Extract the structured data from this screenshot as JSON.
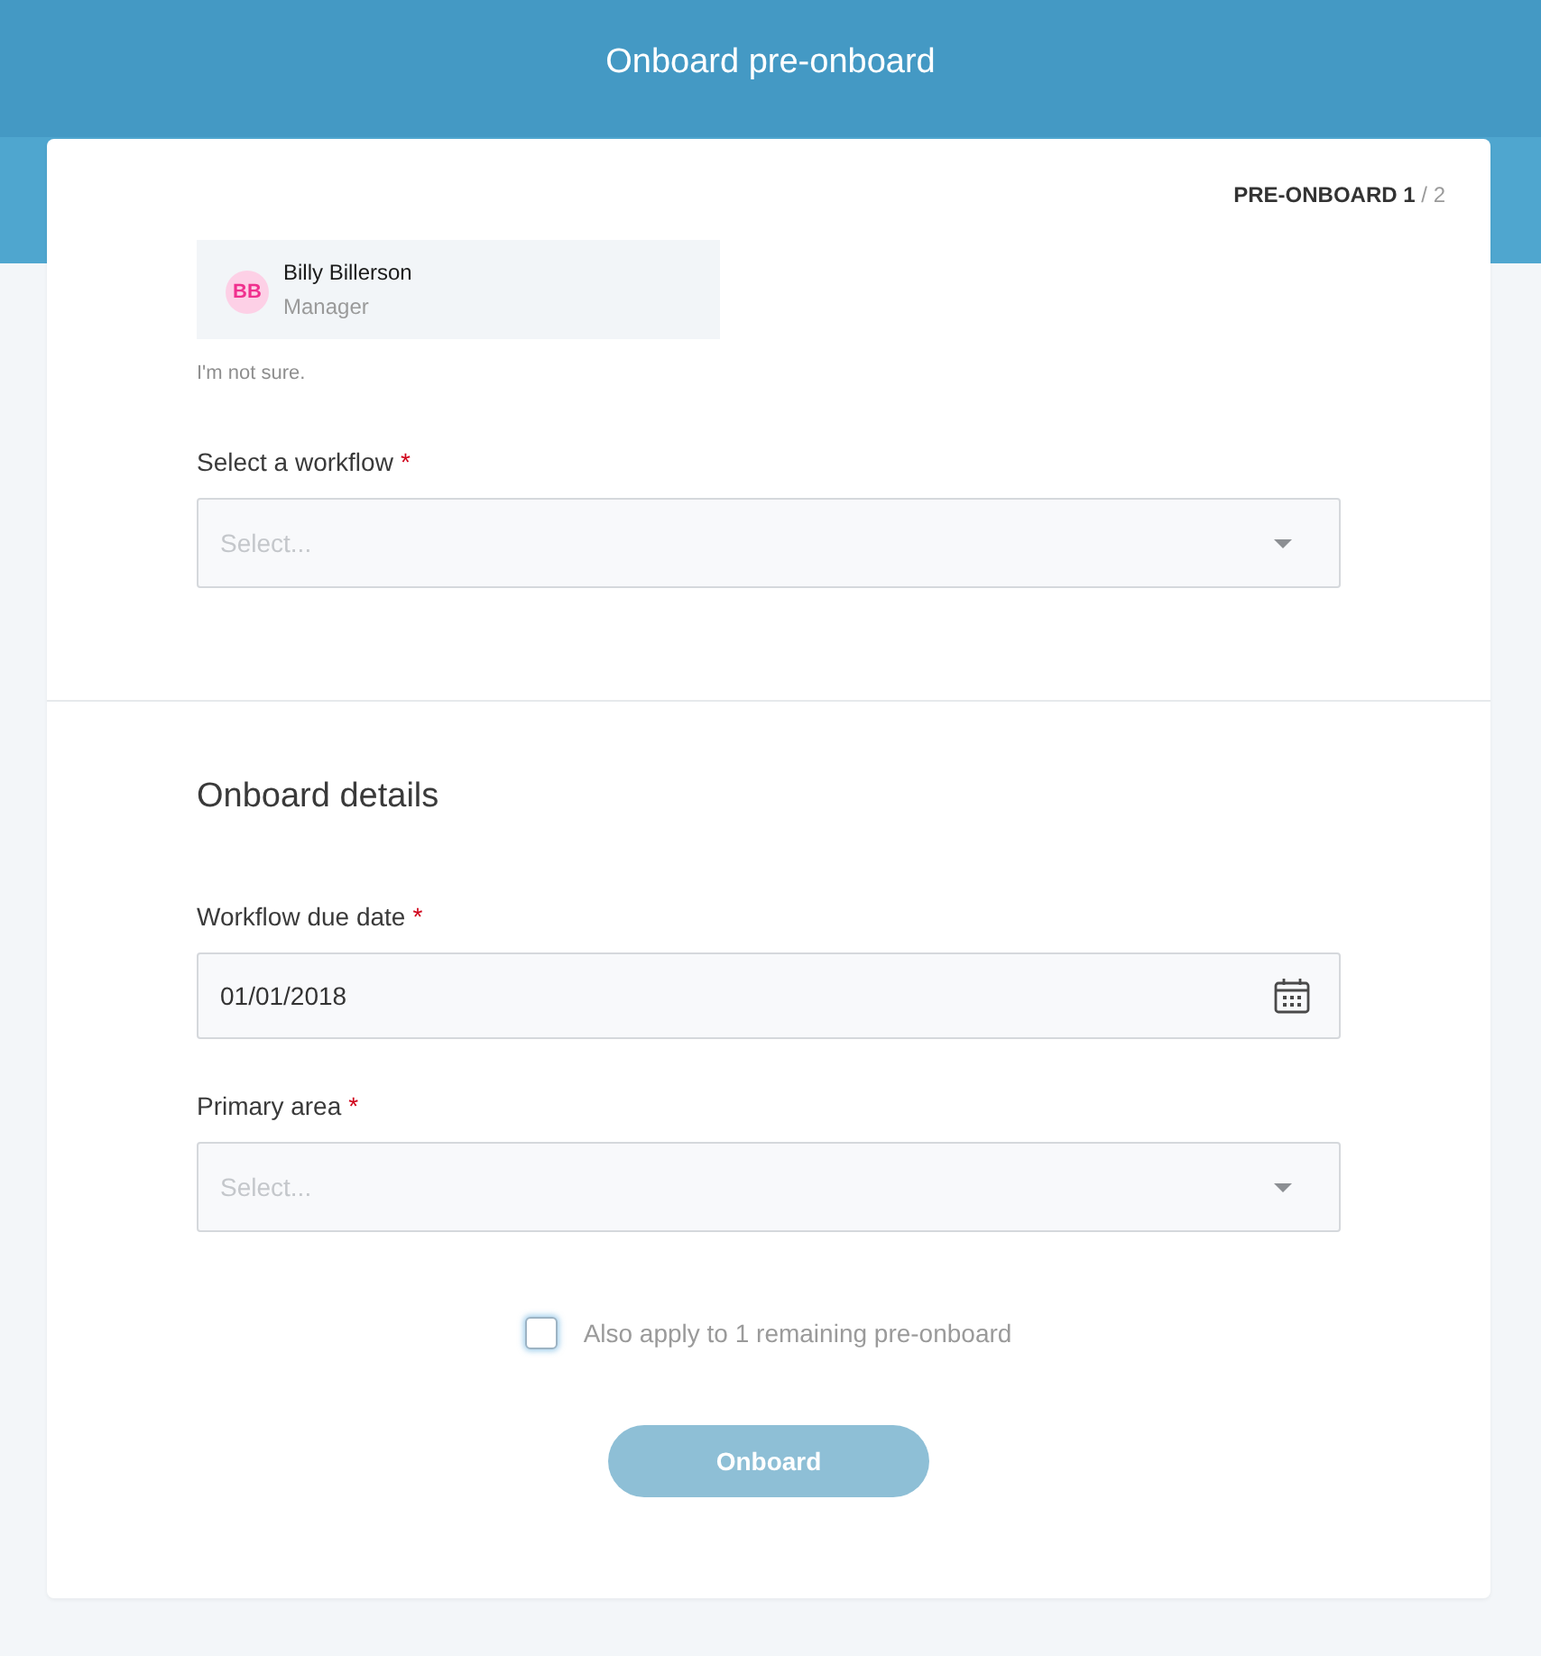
{
  "header": {
    "title": "Onboard pre-onboard"
  },
  "step_indicator": "**PRE-ONBOARD 1** / 2",
  "assignee": {
    "initials": "BB",
    "name": "Billy Billerson",
    "role": "Manager"
  },
  "hint": "I'm not sure.",
  "workflow_field": {
    "kind": "select",
    "label": "Select a workflow",
    "required_mark": "*",
    "placeholder": "Select..."
  },
  "details": {
    "title": "Onboard details",
    "fields": [
      {
        "kind": "date",
        "label": "Workflow due date",
        "required_mark": "*",
        "value": "01/01/2018"
      },
      {
        "kind": "select",
        "label": "Primary area",
        "required_mark": "*",
        "placeholder": "Select..."
      }
    ]
  },
  "apply_all": {
    "label": "Also apply to 1 remaining pre-onboard",
    "checked": false
  },
  "submit": {
    "label": "Onboard",
    "disabled": true
  }
}
